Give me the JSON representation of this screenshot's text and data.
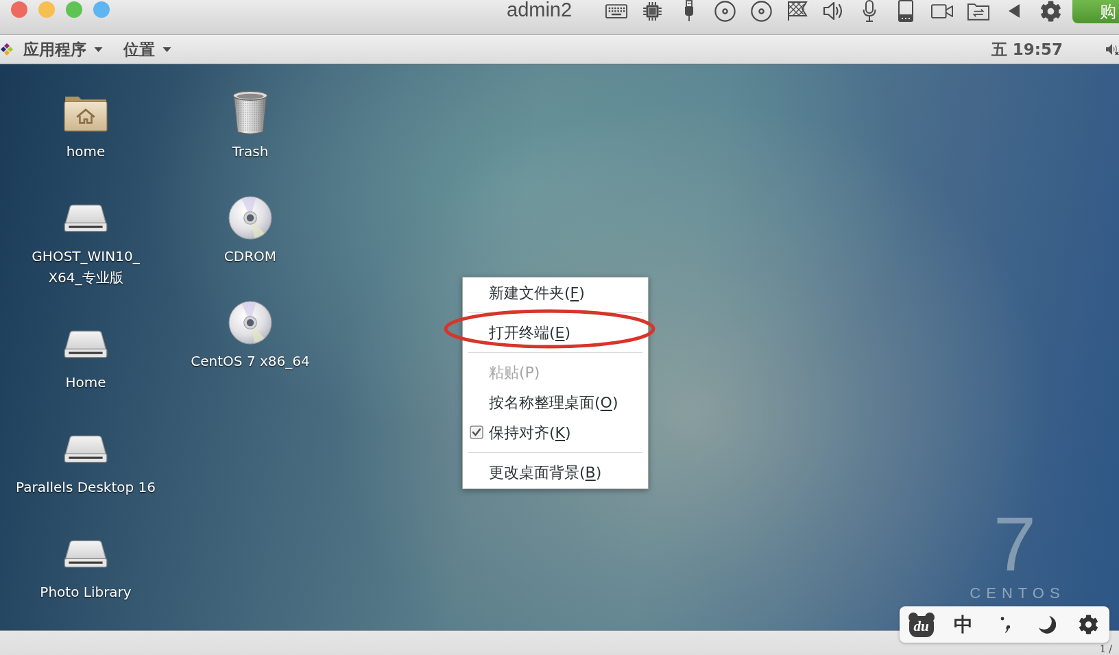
{
  "host_window": {
    "title": "admin2",
    "traffic_lights": [
      {
        "color": "#ee6a5f"
      },
      {
        "color": "#f6bf4f"
      },
      {
        "color": "#60c454"
      },
      {
        "color": "#5fb4f2"
      }
    ],
    "buy_button": {
      "label": "购"
    }
  },
  "top_panel": {
    "menus": [
      {
        "label": "应用程序"
      },
      {
        "label": "位置"
      }
    ],
    "clock": "五 19:57"
  },
  "desktop": {
    "columns": [
      [
        {
          "kind": "home_folder",
          "label_lines": [
            "home"
          ]
        },
        {
          "kind": "drive",
          "label_lines": [
            "GHOST_WIN10_",
            "X64_专业版"
          ]
        },
        {
          "kind": "drive",
          "label_lines": [
            "Home"
          ]
        },
        {
          "kind": "drive",
          "label_lines": [
            "Parallels Desktop 16"
          ]
        },
        {
          "kind": "drive",
          "label_lines": [
            "Photo Library"
          ]
        }
      ],
      [
        {
          "kind": "trash",
          "label_lines": [
            "Trash"
          ]
        },
        {
          "kind": "disc",
          "label_lines": [
            "CDROM"
          ]
        },
        {
          "kind": "disc",
          "label_lines": [
            "CentOS 7 x86_64"
          ]
        }
      ]
    ]
  },
  "context_menu": {
    "items": [
      {
        "kind": "item",
        "label": "新建文件夹(",
        "mnemonic": "F",
        "label_end": ")",
        "disabled": false,
        "circled": false
      },
      {
        "kind": "separator"
      },
      {
        "kind": "item",
        "label": "打开终端(",
        "mnemonic": "E",
        "label_end": ")",
        "disabled": false,
        "circled": true
      },
      {
        "kind": "separator"
      },
      {
        "kind": "item",
        "label": "粘贴(P)",
        "disabled": true,
        "circled": false
      },
      {
        "kind": "item",
        "label": "按名称整理桌面(",
        "mnemonic": "O",
        "label_end": ")",
        "disabled": false,
        "circled": false
      },
      {
        "kind": "check",
        "label": "保持对齐(",
        "mnemonic": "K",
        "label_end": ")",
        "checked": true,
        "disabled": false,
        "circled": false
      },
      {
        "kind": "separator"
      },
      {
        "kind": "item",
        "label": "更改桌面背景(",
        "mnemonic": "B",
        "label_end": ")",
        "disabled": false,
        "circled": false
      }
    ]
  },
  "wallpaper": {
    "logo_number": "7",
    "logo_text": "CENTOS"
  },
  "ime_toolbar": {
    "logo_text": "du",
    "input_mode": "中"
  },
  "bottom_panel": {
    "workspace": "1 /"
  }
}
